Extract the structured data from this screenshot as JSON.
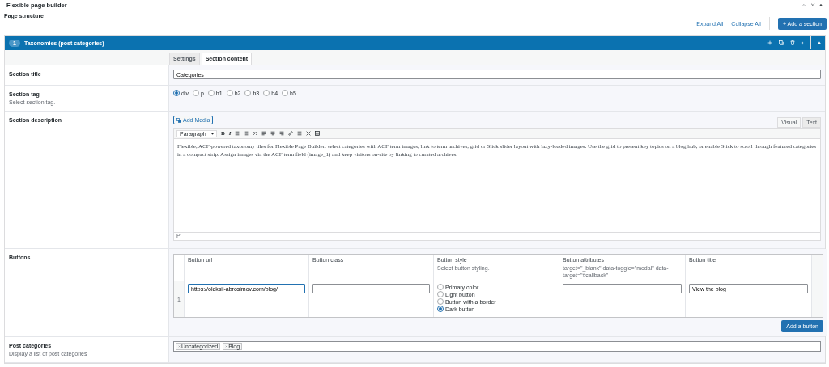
{
  "panel": {
    "title": "Flexible page builder"
  },
  "page_structure": {
    "label": "Page structure",
    "links": [
      "Expand All",
      "Collapse All"
    ],
    "add_button": "+ Add a section"
  },
  "section": {
    "number": "1",
    "title": "Taxonomies (post categories)",
    "tabs": [
      {
        "label": "Settings",
        "selected": false
      },
      {
        "label": "Section content",
        "selected": true
      }
    ],
    "fields": [
      {
        "kind": "text",
        "label": "Section title",
        "value": "Categories"
      },
      {
        "kind": "radio",
        "label": "Section tag",
        "hint": "Select section tag.",
        "options": [
          {
            "label": "div",
            "selected": true
          },
          {
            "label": "p",
            "selected": false
          },
          {
            "label": "h1",
            "selected": false
          },
          {
            "label": "h2",
            "selected": false
          },
          {
            "label": "h3",
            "selected": false
          },
          {
            "label": "h4",
            "selected": false
          },
          {
            "label": "h5",
            "selected": false
          }
        ]
      },
      {
        "kind": "wysiwyg",
        "label": "Section description",
        "media_button": "Add Media",
        "modes": [
          {
            "label": "Visual",
            "selected": true
          },
          {
            "label": "Text",
            "selected": false
          }
        ],
        "format": "Paragraph",
        "text_buttons": [
          "B",
          "I"
        ],
        "content": "Flexible, ACF-powered taxonomy tiles for Flexible Page Builder: select categories with ACF term images, link to term archives, grid or Slick slider layout with lazy-loaded images. Use the grid to present key topics on a blog hub, or enable Slick to scroll through featured categories in a compact strip. Assign images via the ACF term field (image_1) and keep visitors on-site by linking to curated archives.",
        "path": "P"
      },
      {
        "kind": "repeater",
        "label": "Buttons",
        "columns": [
          {
            "title": "Button url"
          },
          {
            "title": "Button class"
          },
          {
            "title": "Button style",
            "hint": "Select button styling."
          },
          {
            "title": "Button attributes",
            "hint": "target=\"_blank\" data-toggle=\"modal\" data-target=\"#callback\""
          },
          {
            "title": "Button title"
          }
        ],
        "rows": [
          {
            "index": "1",
            "url": "https://oleksii-abrosimov.com/blog/",
            "class": "",
            "styles": [
              {
                "label": "Primary color",
                "selected": false
              },
              {
                "label": "Light button",
                "selected": false
              },
              {
                "label": "Button with a border",
                "selected": false
              },
              {
                "label": "Dark button",
                "selected": true
              }
            ],
            "attributes": "",
            "title": "View the blog"
          }
        ],
        "add_button": "Add a button"
      },
      {
        "kind": "tags",
        "label": "Post categories",
        "hint": "Display a list of post categories",
        "tags": [
          "Uncategorized",
          "Blog"
        ]
      }
    ]
  }
}
